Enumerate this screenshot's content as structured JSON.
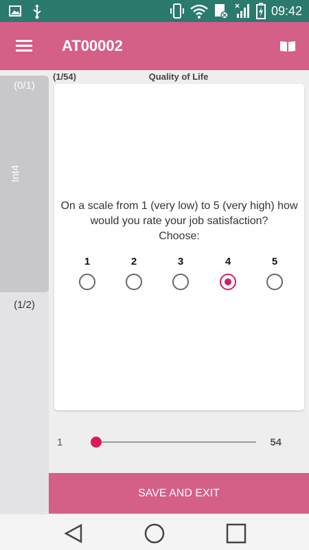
{
  "status_bar": {
    "time": "09:42",
    "icons": [
      "image-icon",
      "usb-icon",
      "vibrate-icon",
      "wifi-icon",
      "sim-error-icon",
      "signal-icon",
      "battery-charging-icon"
    ]
  },
  "app_bar": {
    "title": "AT00002",
    "menu_icon": "menu-icon",
    "book_icon": "book-icon"
  },
  "side_panel": {
    "tab_count": "(0/1)",
    "tab_label": "Int4",
    "group_count": "(1/2)"
  },
  "header": {
    "progress": "(1/54)",
    "section_title": "Quality of Life"
  },
  "question": {
    "text": "On a scale from 1 (very low) to 5 (very high) how would you rate your job satisfaction?",
    "prompt": "Choose:",
    "options": [
      "1",
      "2",
      "3",
      "4",
      "5"
    ],
    "selected": "4"
  },
  "slider": {
    "min": "1",
    "max": "54",
    "current": 1
  },
  "save_button": "SAVE AND EXIT",
  "colors": {
    "status_bar": "#2a7a6e",
    "primary": "#d45f87",
    "accent": "#d81b60"
  },
  "nav_bar": {
    "icons": [
      "back-icon",
      "home-icon",
      "recents-icon"
    ]
  }
}
